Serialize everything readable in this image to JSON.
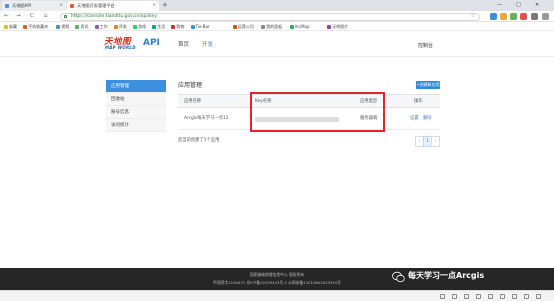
{
  "browser": {
    "tabs": [
      {
        "title": "天地图API",
        "active": false
      },
      {
        "title": "天地图开发管理平台",
        "active": true
      }
    ],
    "new_tab": "+",
    "nav": {
      "back": "←",
      "forward": "→",
      "reload": "C",
      "home": "⌂"
    },
    "address": "https://console.tianditu.gov.cn/api/key",
    "bookmarks": [
      "收藏",
      "手机收藏夹",
      "视频",
      "资讯",
      "工作",
      "开发",
      "游戏",
      "生活",
      "购物",
      "Tie-Bar",
      "运营公司",
      "我的面板",
      "ArcMap",
      "天地图片"
    ]
  },
  "site": {
    "logo_cn": "天地图",
    "logo_en": "MAP WORLD",
    "product": "API",
    "nav": [
      "首页",
      "开发"
    ],
    "console": "控制台"
  },
  "sidebar": {
    "items": [
      {
        "label": "应用管理",
        "active": true
      },
      {
        "label": "回收站",
        "active": false
      },
      {
        "label": "账号信息",
        "active": false
      },
      {
        "label": "访问统计",
        "active": false
      }
    ]
  },
  "main": {
    "title": "应用管理",
    "create_button": "+创建新应用",
    "table": {
      "headers": [
        "应用名称",
        "Key名称",
        "应用类型",
        "操作"
      ],
      "rows": [
        {
          "name": "Arcgis每天学习一点12",
          "key": "",
          "type": "服务器端",
          "ops": [
            "设置",
            "删除"
          ]
        }
      ]
    },
    "footnote": "您当前创建了1个应用",
    "pager": {
      "prev": "‹",
      "current": "1",
      "next": "›"
    }
  },
  "footer": {
    "line1": "国家基础地理信息中心  版权所有",
    "line2": "甲测资字1100471  京ICP备12039443号-2  公网安备11010802015345号"
  },
  "watermark": {
    "text": "每天学习一点Arcgis"
  },
  "colors": {
    "accent": "#3d8fe0",
    "highlight_box": "#e0262a",
    "footer_bg": "#262626",
    "logo_red": "#d4301a"
  }
}
